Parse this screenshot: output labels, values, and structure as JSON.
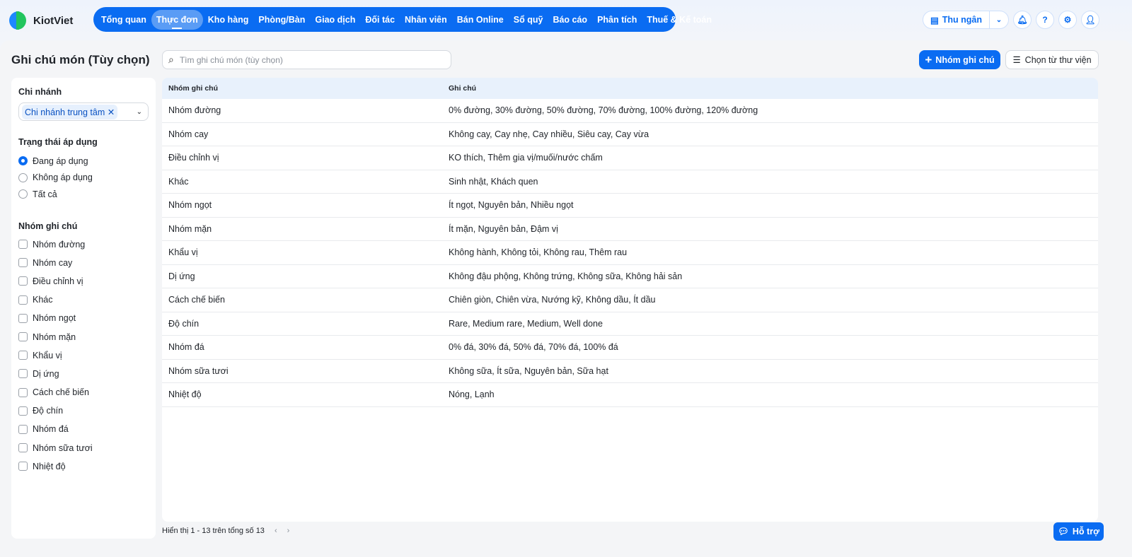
{
  "app": {
    "name": "KiotViet"
  },
  "nav": [
    "Tổng quan",
    "Thực đơn",
    "Kho hàng",
    "Phòng/Bàn",
    "Giao dịch",
    "Đối tác",
    "Nhân viên",
    "Bán Online",
    "Sổ quỹ",
    "Báo cáo",
    "Phân tích",
    "Thuế & Kế toán"
  ],
  "header": {
    "cashier": "Thu ngân"
  },
  "page": {
    "title": "Ghi chú món (Tùy chọn)",
    "search_placeholder": "Tìm ghi chú món (tùy chọn)",
    "add_button": "Nhóm ghi chú",
    "library_button": "Chọn từ thư viện"
  },
  "filters": {
    "branch_label": "Chi nhánh",
    "branch_value": "Chi nhánh trung tâm",
    "status_label": "Trạng thái áp dụng",
    "status_options": [
      "Đang áp dụng",
      "Không áp dụng",
      "Tất cả"
    ],
    "group_label": "Nhóm ghi chú",
    "groups": [
      "Nhóm đường",
      "Nhóm cay",
      "Điều chỉnh vị",
      "Khác",
      "Nhóm ngọt",
      "Nhóm mặn",
      "Khẩu vị",
      "Dị ứng",
      "Cách chế biến",
      "Độ chín",
      "Nhóm đá",
      "Nhóm sữa tươi",
      "Nhiệt độ"
    ]
  },
  "table": {
    "headers": [
      "Nhóm ghi chú",
      "Ghi chú"
    ],
    "rows": [
      [
        "Nhóm đường",
        "0% đường, 30% đường, 50% đường, 70% đường, 100% đường, 120% đường"
      ],
      [
        "Nhóm cay",
        "Không cay, Cay nhẹ, Cay nhiều, Siêu cay, Cay vừa"
      ],
      [
        "Điều chỉnh vị",
        "KO thích, Thêm gia vị/muối/nước chấm"
      ],
      [
        "Khác",
        "Sinh nhật, Khách quen"
      ],
      [
        "Nhóm ngọt",
        "Ít ngọt, Nguyên bản, Nhiều ngọt"
      ],
      [
        "Nhóm mặn",
        "Ít mặn, Nguyên bản, Đậm vị"
      ],
      [
        "Khẩu vị",
        "Không hành, Không tỏi, Không rau, Thêm rau"
      ],
      [
        "Dị ứng",
        "Không đậu phộng, Không trứng, Không sữa, Không hải sản"
      ],
      [
        "Cách chế biến",
        "Chiên giòn, Chiên vừa, Nướng kỹ, Không dầu, Ít dầu"
      ],
      [
        "Độ chín",
        "Rare, Medium rare, Medium, Well done"
      ],
      [
        "Nhóm đá",
        "0% đá, 30% đá, 50% đá, 70% đá, 100% đá"
      ],
      [
        "Nhóm sữa tươi",
        "Không sữa, Ít sữa, Nguyên bản, Sữa hạt"
      ],
      [
        "Nhiệt độ",
        "Nóng, Lạnh"
      ]
    ]
  },
  "pagination": {
    "text": "Hiển thị 1 - 13 trên tổng số 13"
  },
  "help": {
    "label": "Hỗ trợ"
  }
}
